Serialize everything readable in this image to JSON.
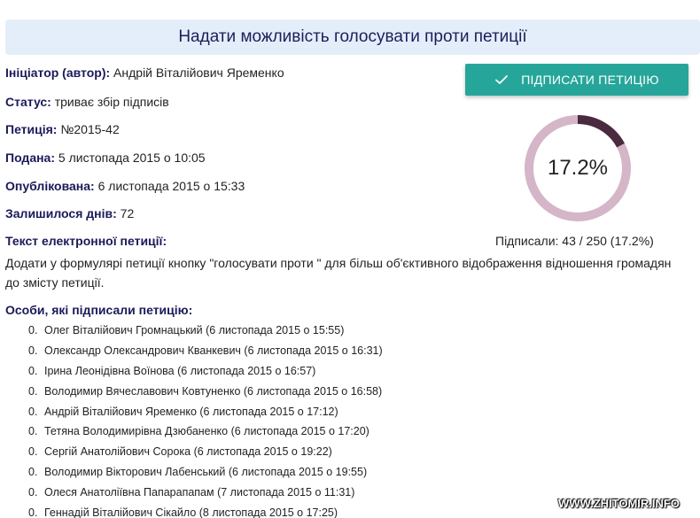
{
  "header": {
    "title": "Надати можливість голосувати проти петиції"
  },
  "details": {
    "initiator_label": "Ініціатор (автор):",
    "initiator_value": " Андрій Віталійович Яременко",
    "status_label": "Статус:",
    "status_value": " триває збір підписів",
    "petition_label": "Петиція:",
    "petition_value": " №2015-42",
    "submitted_label": "Подана:",
    "submitted_value": " 5 листопада 2015 о 10:05",
    "published_label": "Опублікована:",
    "published_value": " 6 листопада 2015 о 15:33",
    "days_left_label": "Залишилося днів:",
    "days_left_value": " 72"
  },
  "sign_button": {
    "label": "ПІДПИСАТИ ПЕТИЦІЮ",
    "icon": "check-icon"
  },
  "progress": {
    "percent_text": "17.2%",
    "fraction": 0.172,
    "signed_text": "Підписали: 43 / 250 (17.2%)",
    "fill_color": "#4a2a3f",
    "track_color": "#d4b6c8"
  },
  "petition_text": {
    "label": "Текст електронної петиції:",
    "body": "Додати у формулярі петиції кнопку \"голосувати проти \" для більш об'єктивного відображення відношення громадян до змісту петиції."
  },
  "signers": {
    "label": "Особи, які підписали петицію:",
    "items": [
      {
        "num": "0.",
        "text": "Олег Віталійович Громнацький (6 листопада 2015 о 15:55)"
      },
      {
        "num": "0.",
        "text": "Олександр Олександрович Кванкевич (6 листопада 2015 о 16:31)"
      },
      {
        "num": "0.",
        "text": "Ірина Леонідівна Воїнова (6 листопада 2015 о 16:57)"
      },
      {
        "num": "0.",
        "text": "Володимир Вячеславович Ковтуненко (6 листопада 2015 о 16:58)"
      },
      {
        "num": "0.",
        "text": "Андрій Віталійович Яременко (6 листопада 2015 о 17:12)"
      },
      {
        "num": "0.",
        "text": "Тетяна Володимирівна Дзюбаненко (6 листопада 2015 о 17:20)"
      },
      {
        "num": "0.",
        "text": "Сергій Анатолійович Сорока (6 листопада 2015 о 19:22)"
      },
      {
        "num": "0.",
        "text": "Володимир Вікторович Лабенський (6 листопада 2015 о 19:55)"
      },
      {
        "num": "0.",
        "text": "Олеся Анатоліївна Папарапапам (7 листопада 2015 о 11:31)"
      },
      {
        "num": "0.",
        "text": "Геннадій Віталійович Сікайло (8 листопада 2015 о 17:25)"
      }
    ]
  },
  "watermark": {
    "text": "WWW.ZHITOMIR.INFO"
  }
}
